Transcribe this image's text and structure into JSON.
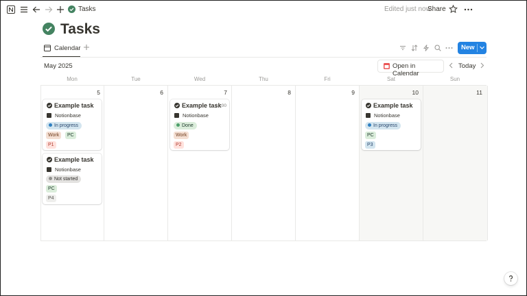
{
  "topbar": {
    "breadcrumb_title": "Tasks",
    "edited_text": "Edited just now",
    "share_label": "Share"
  },
  "page": {
    "title": "Tasks"
  },
  "views": {
    "active_tab_label": "Calendar",
    "new_label": "New"
  },
  "calendar": {
    "month_label": "May 2025",
    "open_in_calendar_label": "Open in Calendar",
    "today_label": "Today",
    "weekdays": [
      "Mon",
      "Tue",
      "Wed",
      "Thu",
      "Fri",
      "Sat",
      "Sun"
    ],
    "day_numbers": [
      "5",
      "6",
      "7",
      "8",
      "9",
      "10",
      "11"
    ],
    "cards": [
      {
        "day": 0,
        "title": "Example task",
        "time": "",
        "source": "Notionbase",
        "status": "In progress",
        "tags": [
          "Work",
          "PC"
        ],
        "priority": "P1"
      },
      {
        "day": 0,
        "title": "Example task",
        "time": "",
        "source": "Notionbase",
        "status": "Not started",
        "tags": [
          "PC"
        ],
        "priority": "P4"
      },
      {
        "day": 2,
        "title": "Example task",
        "time": "18:00",
        "source": "Notionbase",
        "status": "Done",
        "tags": [
          "Work"
        ],
        "priority": "P2"
      },
      {
        "day": 5,
        "title": "Example task",
        "time": "",
        "source": "Notionbase",
        "status": "In progress",
        "tags": [
          "PC"
        ],
        "priority": "P3"
      }
    ]
  },
  "colors": {
    "accent": "#2383e2",
    "status_in_progress_bg": "#d3e5ef",
    "status_in_progress_dot": "#2f7fc1",
    "status_in_progress_text": "#28456c",
    "status_done_bg": "#dbeddb",
    "status_done_dot": "#4d9f6b",
    "status_done_text": "#1c3829",
    "status_not_started_bg": "#e3e2e0",
    "status_not_started_dot": "#91918e",
    "status_not_started_text": "#32302c",
    "tag_work_bg": "#f4dfd3",
    "tag_work_text": "#6f3d1d",
    "tag_pc_bg": "#dbeddb",
    "tag_pc_text": "#1c3829",
    "p1_bg": "#ffe2dd",
    "p1_text": "#b13a2e",
    "p2_bg": "#ffe2dd",
    "p2_text": "#b13a2e",
    "p3_bg": "#d3e5ef",
    "p3_text": "#28456c",
    "p4_bg": "#eeeeec",
    "p4_text": "#55534e"
  }
}
